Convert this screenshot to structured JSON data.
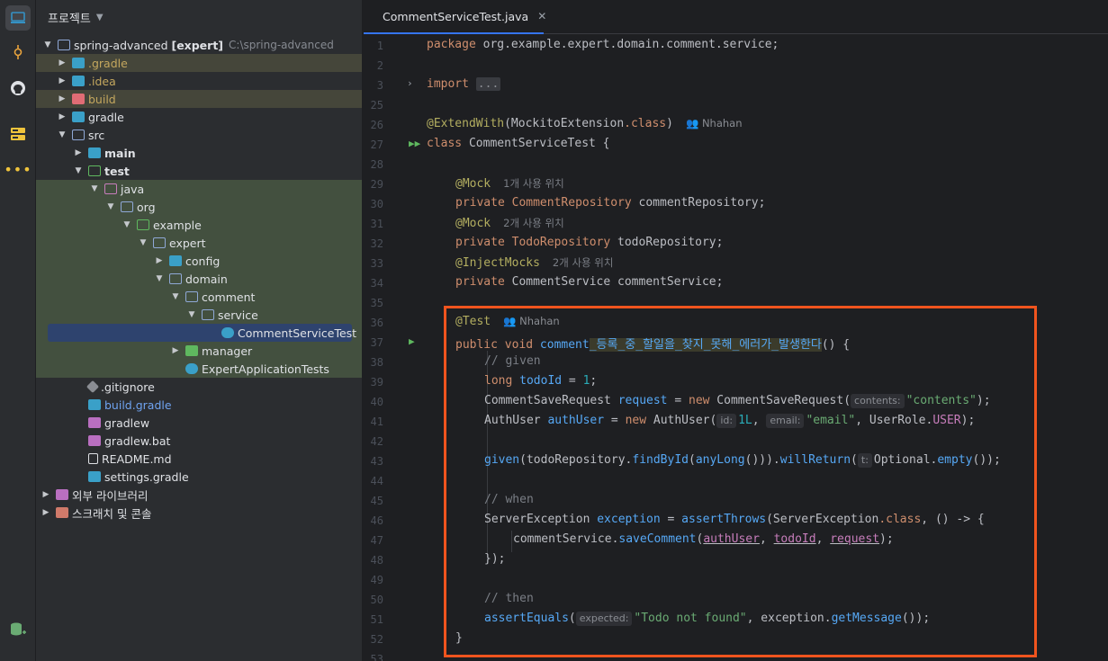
{
  "project_panel": {
    "title": "프로젝트",
    "root_name": "spring-advanced",
    "root_module": "[expert]",
    "root_path": "C:\\spring-advanced",
    "tree": [
      {
        "label": ".gradle"
      },
      {
        "label": ".idea"
      },
      {
        "label": "build"
      },
      {
        "label": "gradle"
      },
      {
        "label": "src"
      },
      {
        "label": "main"
      },
      {
        "label": "test"
      },
      {
        "label": "java"
      },
      {
        "label": "org"
      },
      {
        "label": "example"
      },
      {
        "label": "expert"
      },
      {
        "label": "config"
      },
      {
        "label": "domain"
      },
      {
        "label": "comment"
      },
      {
        "label": "service"
      },
      {
        "label": "CommentServiceTest"
      },
      {
        "label": "manager"
      },
      {
        "label": "ExpertApplicationTests"
      },
      {
        "label": ".gitignore"
      },
      {
        "label": "build.gradle"
      },
      {
        "label": "gradlew"
      },
      {
        "label": "gradlew.bat"
      },
      {
        "label": "README.md"
      },
      {
        "label": "settings.gradle"
      },
      {
        "label": "외부 라이브러리"
      },
      {
        "label": "스크래치 및 콘솔"
      }
    ]
  },
  "editor": {
    "tab_label": "CommentServiceTest.java",
    "line_numbers": [
      "1",
      "2",
      "3",
      "25",
      "26",
      "27",
      "28",
      "29",
      "30",
      "31",
      "32",
      "33",
      "34",
      "35",
      "36",
      "37",
      "38",
      "39",
      "40",
      "41",
      "42",
      "43",
      "44",
      "45",
      "46",
      "47",
      "48",
      "49",
      "50",
      "51",
      "52",
      "53"
    ],
    "author": "Nhahan",
    "usage_1": "1개 사용 위치",
    "usage_2": "2개 사용 위치",
    "usage_3": "2개 사용 위치",
    "code": {
      "package_kw": "package",
      "package_name": " org.example.expert.domain.comment.service;",
      "import_kw": "import",
      "import_fold": "...",
      "extend_ann": "@ExtendWith",
      "extend_arg": "MockitoExtension",
      "class_kw": ".class",
      "class_decl_kw": "class",
      "class_name": " CommentServiceTest {",
      "mock_ann": "@Mock",
      "inject_ann": "@InjectMocks",
      "private_kw": "private",
      "repo_type": "CommentRepository",
      "repo_name": " commentRepository;",
      "todo_type": "TodoRepository",
      "todo_name": " todoRepository;",
      "service_type": " CommentService",
      "service_name": " commentService;",
      "test_ann": "@Test",
      "public_void": "public void",
      "method_prefix": " comment",
      "method_korean": "_등록_중_할일을_찾지_못해_에러가_발생한다",
      "method_suffix": "() {",
      "cm_given": "// given",
      "long_kw": "long",
      "todo_id": " todoId",
      "eq1": " = ",
      "one": "1",
      "semi": ";",
      "csr_type": "CommentSaveRequest",
      "request_var": " request",
      "new_kw": "new",
      "csr_ctor": " CommentSaveRequest(",
      "hint_contents": "contents:",
      "str_contents": "\"contents\"",
      "close_semi": ");",
      "au_type": "AuthUser",
      "au_var": " authUser",
      "au_ctor": " AuthUser(",
      "hint_id": "id:",
      "one_l": "1L",
      "comma": ", ",
      "hint_email": "email:",
      "str_email": "\"email\"",
      "role": ", UserRole.",
      "role_user": "USER",
      "given_fn": "given",
      "given_arg": "(todoRepository.",
      "find_fn": "findById",
      "any_fn": "anyLong",
      "will_fn": "willReturn",
      "hint_t": "t:",
      "opt": "Optional.",
      "empty_fn": "empty",
      "cm_when": "// when",
      "se_type": "ServerException",
      "exc_var": " exception",
      "assert_throws": "assertThrows",
      "se_arg": "(ServerException",
      "lambda": ", () -> {",
      "svc_call": "commentService.",
      "save_fn": "saveComment",
      "arg_auth": "authUser",
      "arg_todo": "todoId",
      "arg_req": "request",
      "close_lambda": "});",
      "cm_then": "// then",
      "assert_eq": "assertEquals",
      "hint_expected": "expected:",
      "str_todo": "\"Todo not found\"",
      "exc_get": ", exception.",
      "get_fn": "getMessage",
      "brace_close": "}"
    }
  }
}
